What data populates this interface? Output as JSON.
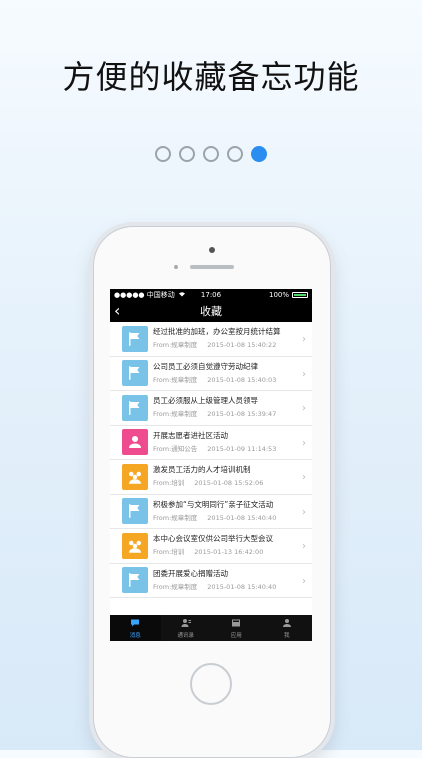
{
  "headline": "方便的收藏备忘功能",
  "pagination": {
    "count": 5,
    "active_index": 4
  },
  "status_bar": {
    "carrier": "●●●●● 中国移动",
    "time": "17:06",
    "battery": "100%"
  },
  "nav": {
    "title": "收藏",
    "back_glyph": "‹"
  },
  "items": [
    {
      "icon": "flag-icon",
      "icon_color": "#79c2e8",
      "title": "经过批准的加班，办公室按月统计结算",
      "source": "From:规章制度",
      "time": "2015-01-08 15:40:22"
    },
    {
      "icon": "flag-icon",
      "icon_color": "#79c2e8",
      "title": "公司员工必须自觉遵守劳动纪律",
      "source": "From:规章制度",
      "time": "2015-01-08 15:40:03"
    },
    {
      "icon": "flag-icon",
      "icon_color": "#79c2e8",
      "title": "员工必须服从上级管理人员领导",
      "source": "From:规章制度",
      "time": "2015-01-08 15:39:47"
    },
    {
      "icon": "person-icon",
      "icon_color": "#ef4c8f",
      "title": "开展志愿者进社区活动",
      "source": "From:通知公告",
      "time": "2015-01-09 11:14:53"
    },
    {
      "icon": "group-icon",
      "icon_color": "#f5a623",
      "title": "激发员工活力的人才培训机制",
      "source": "From:培训",
      "time": "2015-01-08 15:52:06"
    },
    {
      "icon": "flag-icon",
      "icon_color": "#79c2e8",
      "title": "积极参加“与文明同行”亲子征文活动",
      "source": "From:规章制度",
      "time": "2015-01-08 15:40:40"
    },
    {
      "icon": "group-icon",
      "icon_color": "#f5a623",
      "title": "本中心会议室仅供公司举行大型会议",
      "source": "From:培训",
      "time": "2015-01-13 16:42:00"
    },
    {
      "icon": "flag-icon",
      "icon_color": "#79c2e8",
      "title": "团委开展爱心捐赠活动",
      "source": "From:规章制度",
      "time": "2015-01-08 15:40:40"
    }
  ],
  "tabs": [
    {
      "label": "消息",
      "icon": "chat-icon",
      "active": true
    },
    {
      "label": "通讯录",
      "icon": "contacts-icon",
      "active": false
    },
    {
      "label": "应用",
      "icon": "app-icon",
      "active": false
    },
    {
      "label": "我",
      "icon": "user-icon",
      "active": false
    }
  ]
}
